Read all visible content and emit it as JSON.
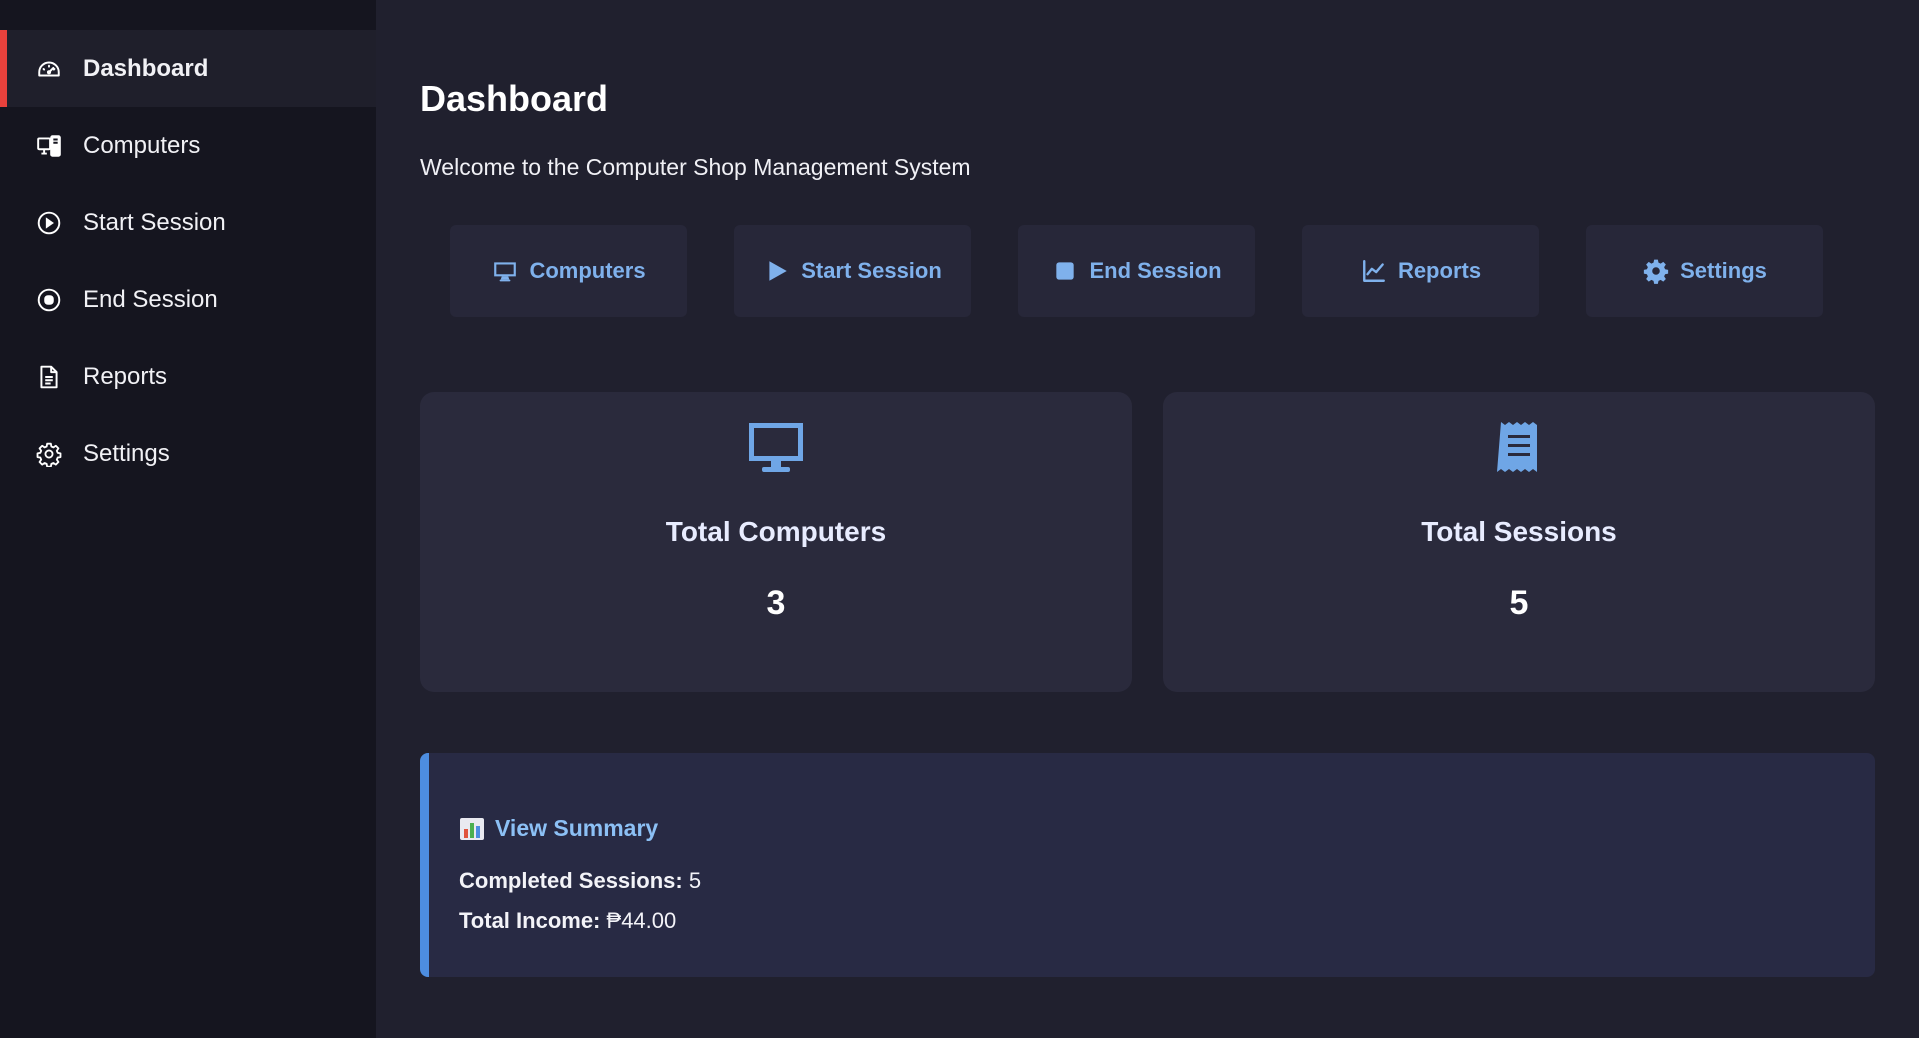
{
  "sidebar": {
    "items": [
      {
        "label": "Dashboard",
        "icon": "gauge-icon",
        "active": true
      },
      {
        "label": "Computers",
        "icon": "devices-icon"
      },
      {
        "label": "Start Session",
        "icon": "play-circle-icon"
      },
      {
        "label": "End Session",
        "icon": "stop-circle-icon"
      },
      {
        "label": "Reports",
        "icon": "document-icon"
      },
      {
        "label": "Settings",
        "icon": "gear-icon"
      }
    ]
  },
  "main": {
    "title": "Dashboard",
    "subtitle": "Welcome to the Computer Shop Management System",
    "quick_actions": [
      {
        "label": "Computers",
        "icon": "desktop-icon"
      },
      {
        "label": "Start Session",
        "icon": "play-icon"
      },
      {
        "label": "End Session",
        "icon": "stop-icon"
      },
      {
        "label": "Reports",
        "icon": "line-chart-icon"
      },
      {
        "label": "Settings",
        "icon": "gear-icon"
      }
    ],
    "stats": [
      {
        "label": "Total Computers",
        "value": "3",
        "icon": "desktop-icon"
      },
      {
        "label": "Total Sessions",
        "value": "5",
        "icon": "receipt-icon"
      }
    ],
    "summary": {
      "title": "View Summary",
      "icon": "bar-chart-emoji-icon",
      "completed_label": "Completed Sessions:",
      "completed_value": "5",
      "income_label": "Total Income:",
      "income_value": "₱44.00"
    }
  },
  "colors": {
    "accent_red": "#e8413c",
    "accent_blue": "#7fb1ec",
    "summary_border": "#4d8de0",
    "sidebar_bg": "#15151f",
    "main_bg": "#20202e"
  }
}
